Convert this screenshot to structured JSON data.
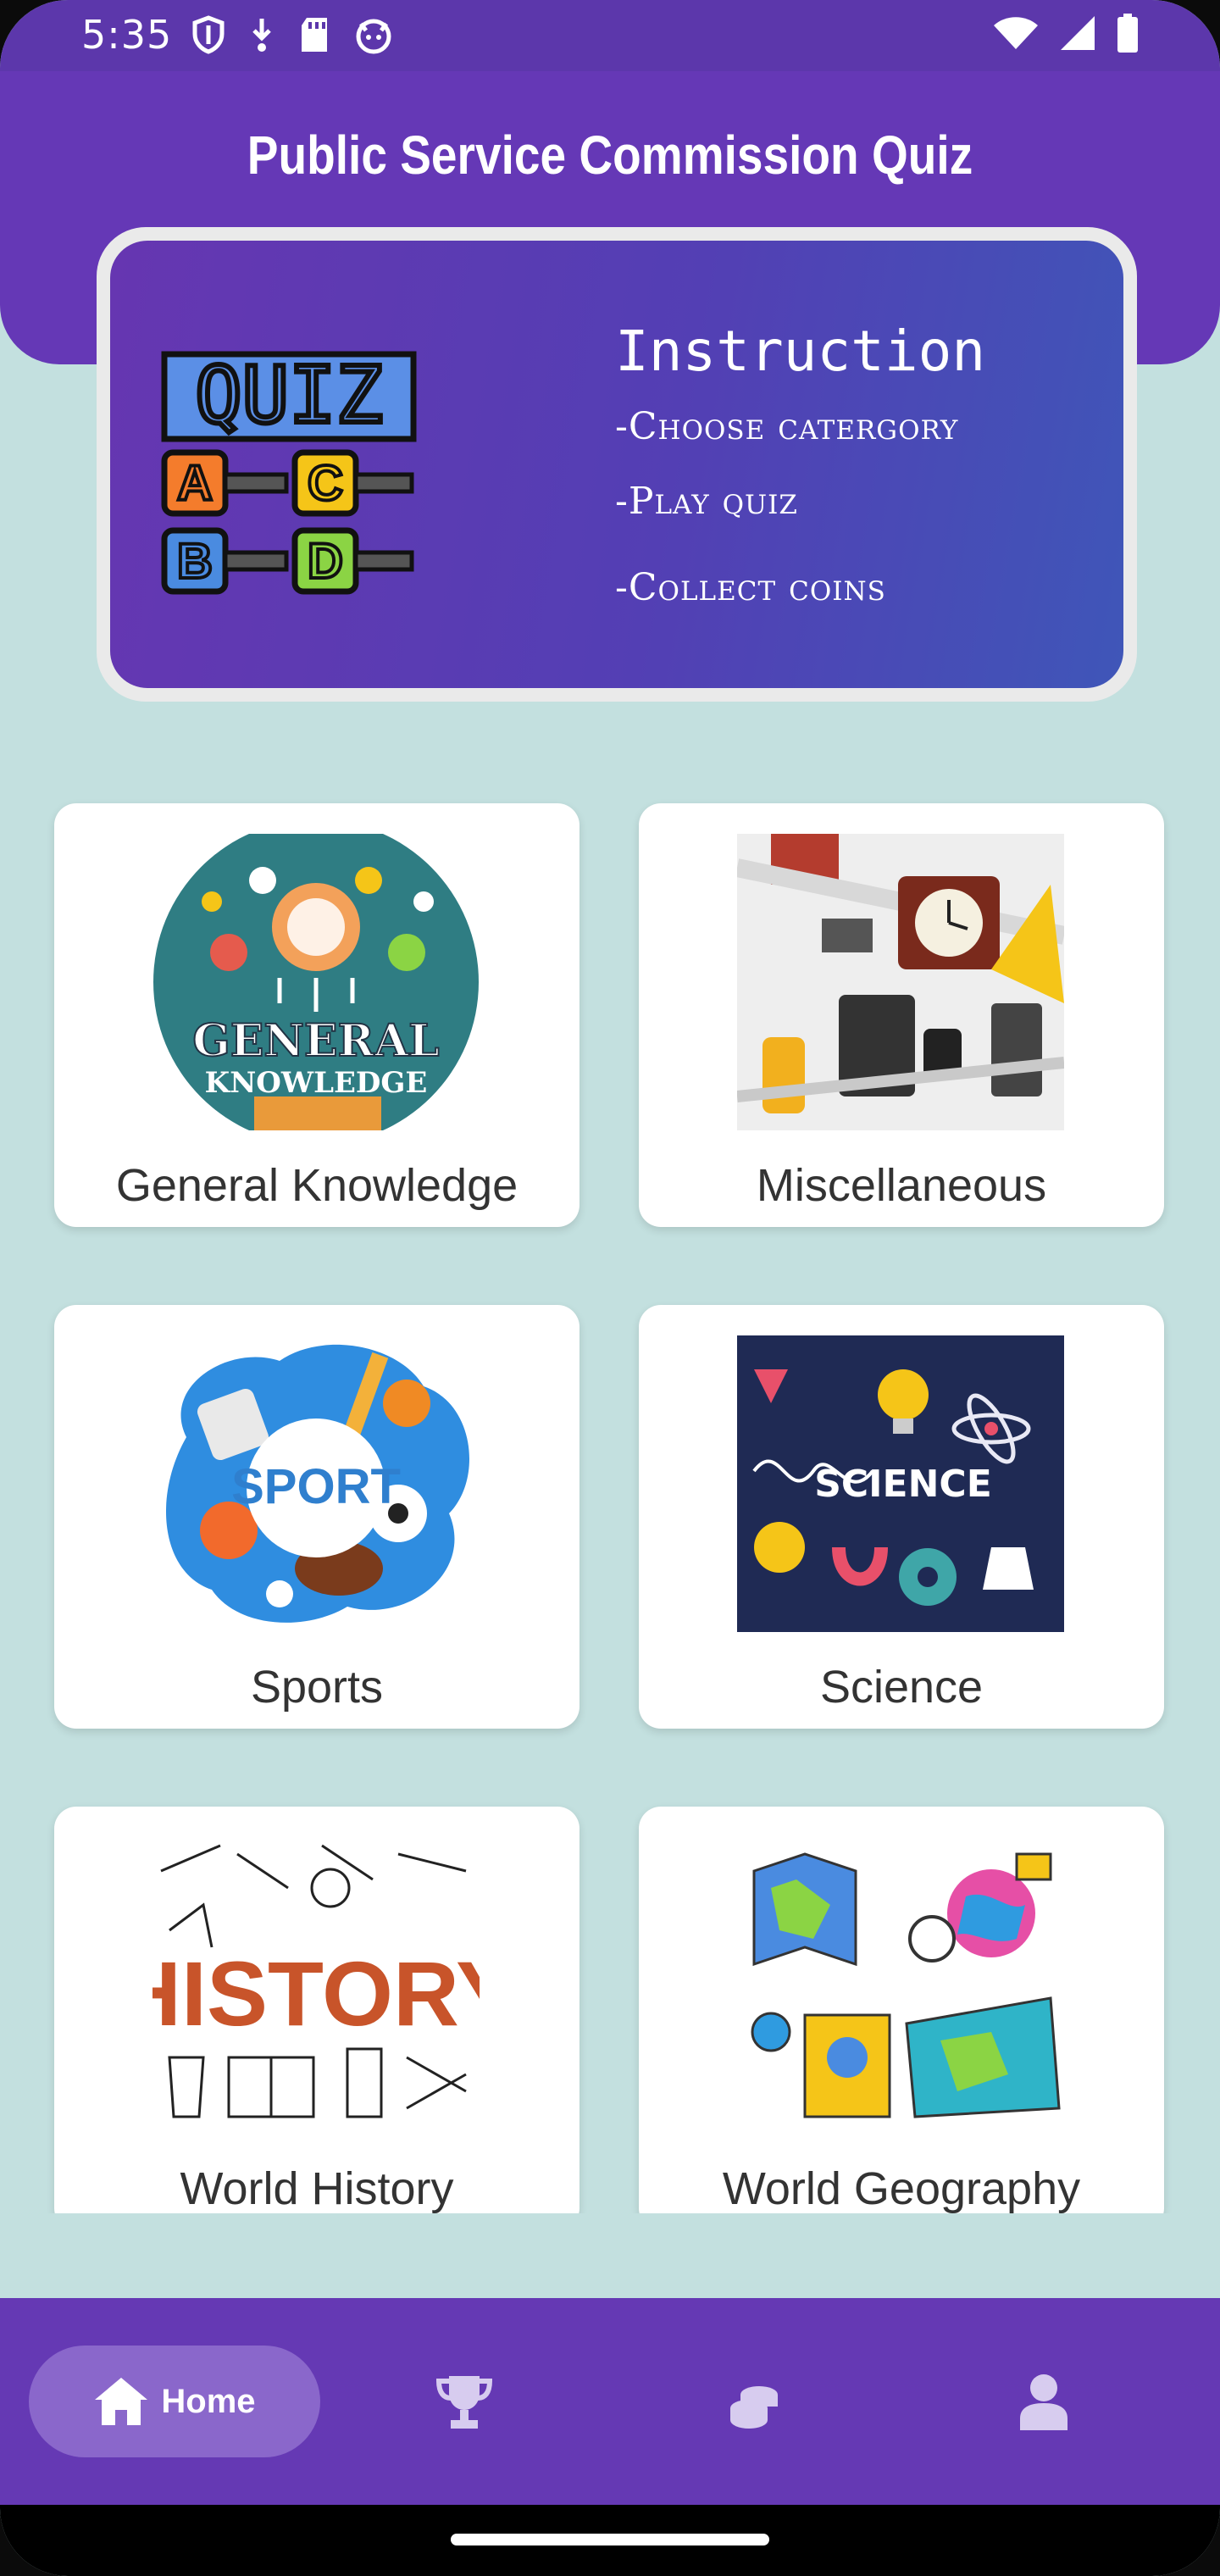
{
  "status_bar": {
    "time": "5:35",
    "left_icons": [
      "shield-icon",
      "download-icon",
      "sd-card-icon",
      "cat-face-icon"
    ],
    "right_icons": [
      "wifi-icon",
      "signal-icon",
      "battery-icon"
    ]
  },
  "header": {
    "title": "Public Service Commission Quiz"
  },
  "instruction": {
    "logo_word": "QUIZ",
    "logo_options": [
      "A",
      "C",
      "B",
      "D"
    ],
    "title": "Instruction",
    "lines": [
      "-Choose catergory",
      "-Play quiz",
      "-Collect coins"
    ]
  },
  "categories": [
    {
      "label": "General Knowledge",
      "image_text": [
        "GENERAL",
        "KNOWLEDGE"
      ],
      "icon": "general-knowledge-image"
    },
    {
      "label": "Miscellaneous",
      "icon": "tools-image"
    },
    {
      "label": "Sports",
      "image_text": [
        "SPORT"
      ],
      "icon": "sport-image"
    },
    {
      "label": "Science",
      "image_text": [
        "SCIENCE"
      ],
      "icon": "science-image"
    },
    {
      "label": "World History",
      "image_text": [
        "HISTORY"
      ],
      "icon": "history-image"
    },
    {
      "label": "World Geography",
      "icon": "geography-image"
    }
  ],
  "bottom_nav": {
    "items": [
      {
        "label": "Home",
        "icon": "home-icon",
        "active": true
      },
      {
        "label": "",
        "icon": "trophy-icon",
        "active": false
      },
      {
        "label": "",
        "icon": "coins-icon",
        "active": false
      },
      {
        "label": "",
        "icon": "profile-icon",
        "active": false
      }
    ]
  },
  "colors": {
    "primary": "#6538b6",
    "background": "#c3e0df",
    "nav_active": "#8a67cb",
    "card": "#ffffff"
  }
}
